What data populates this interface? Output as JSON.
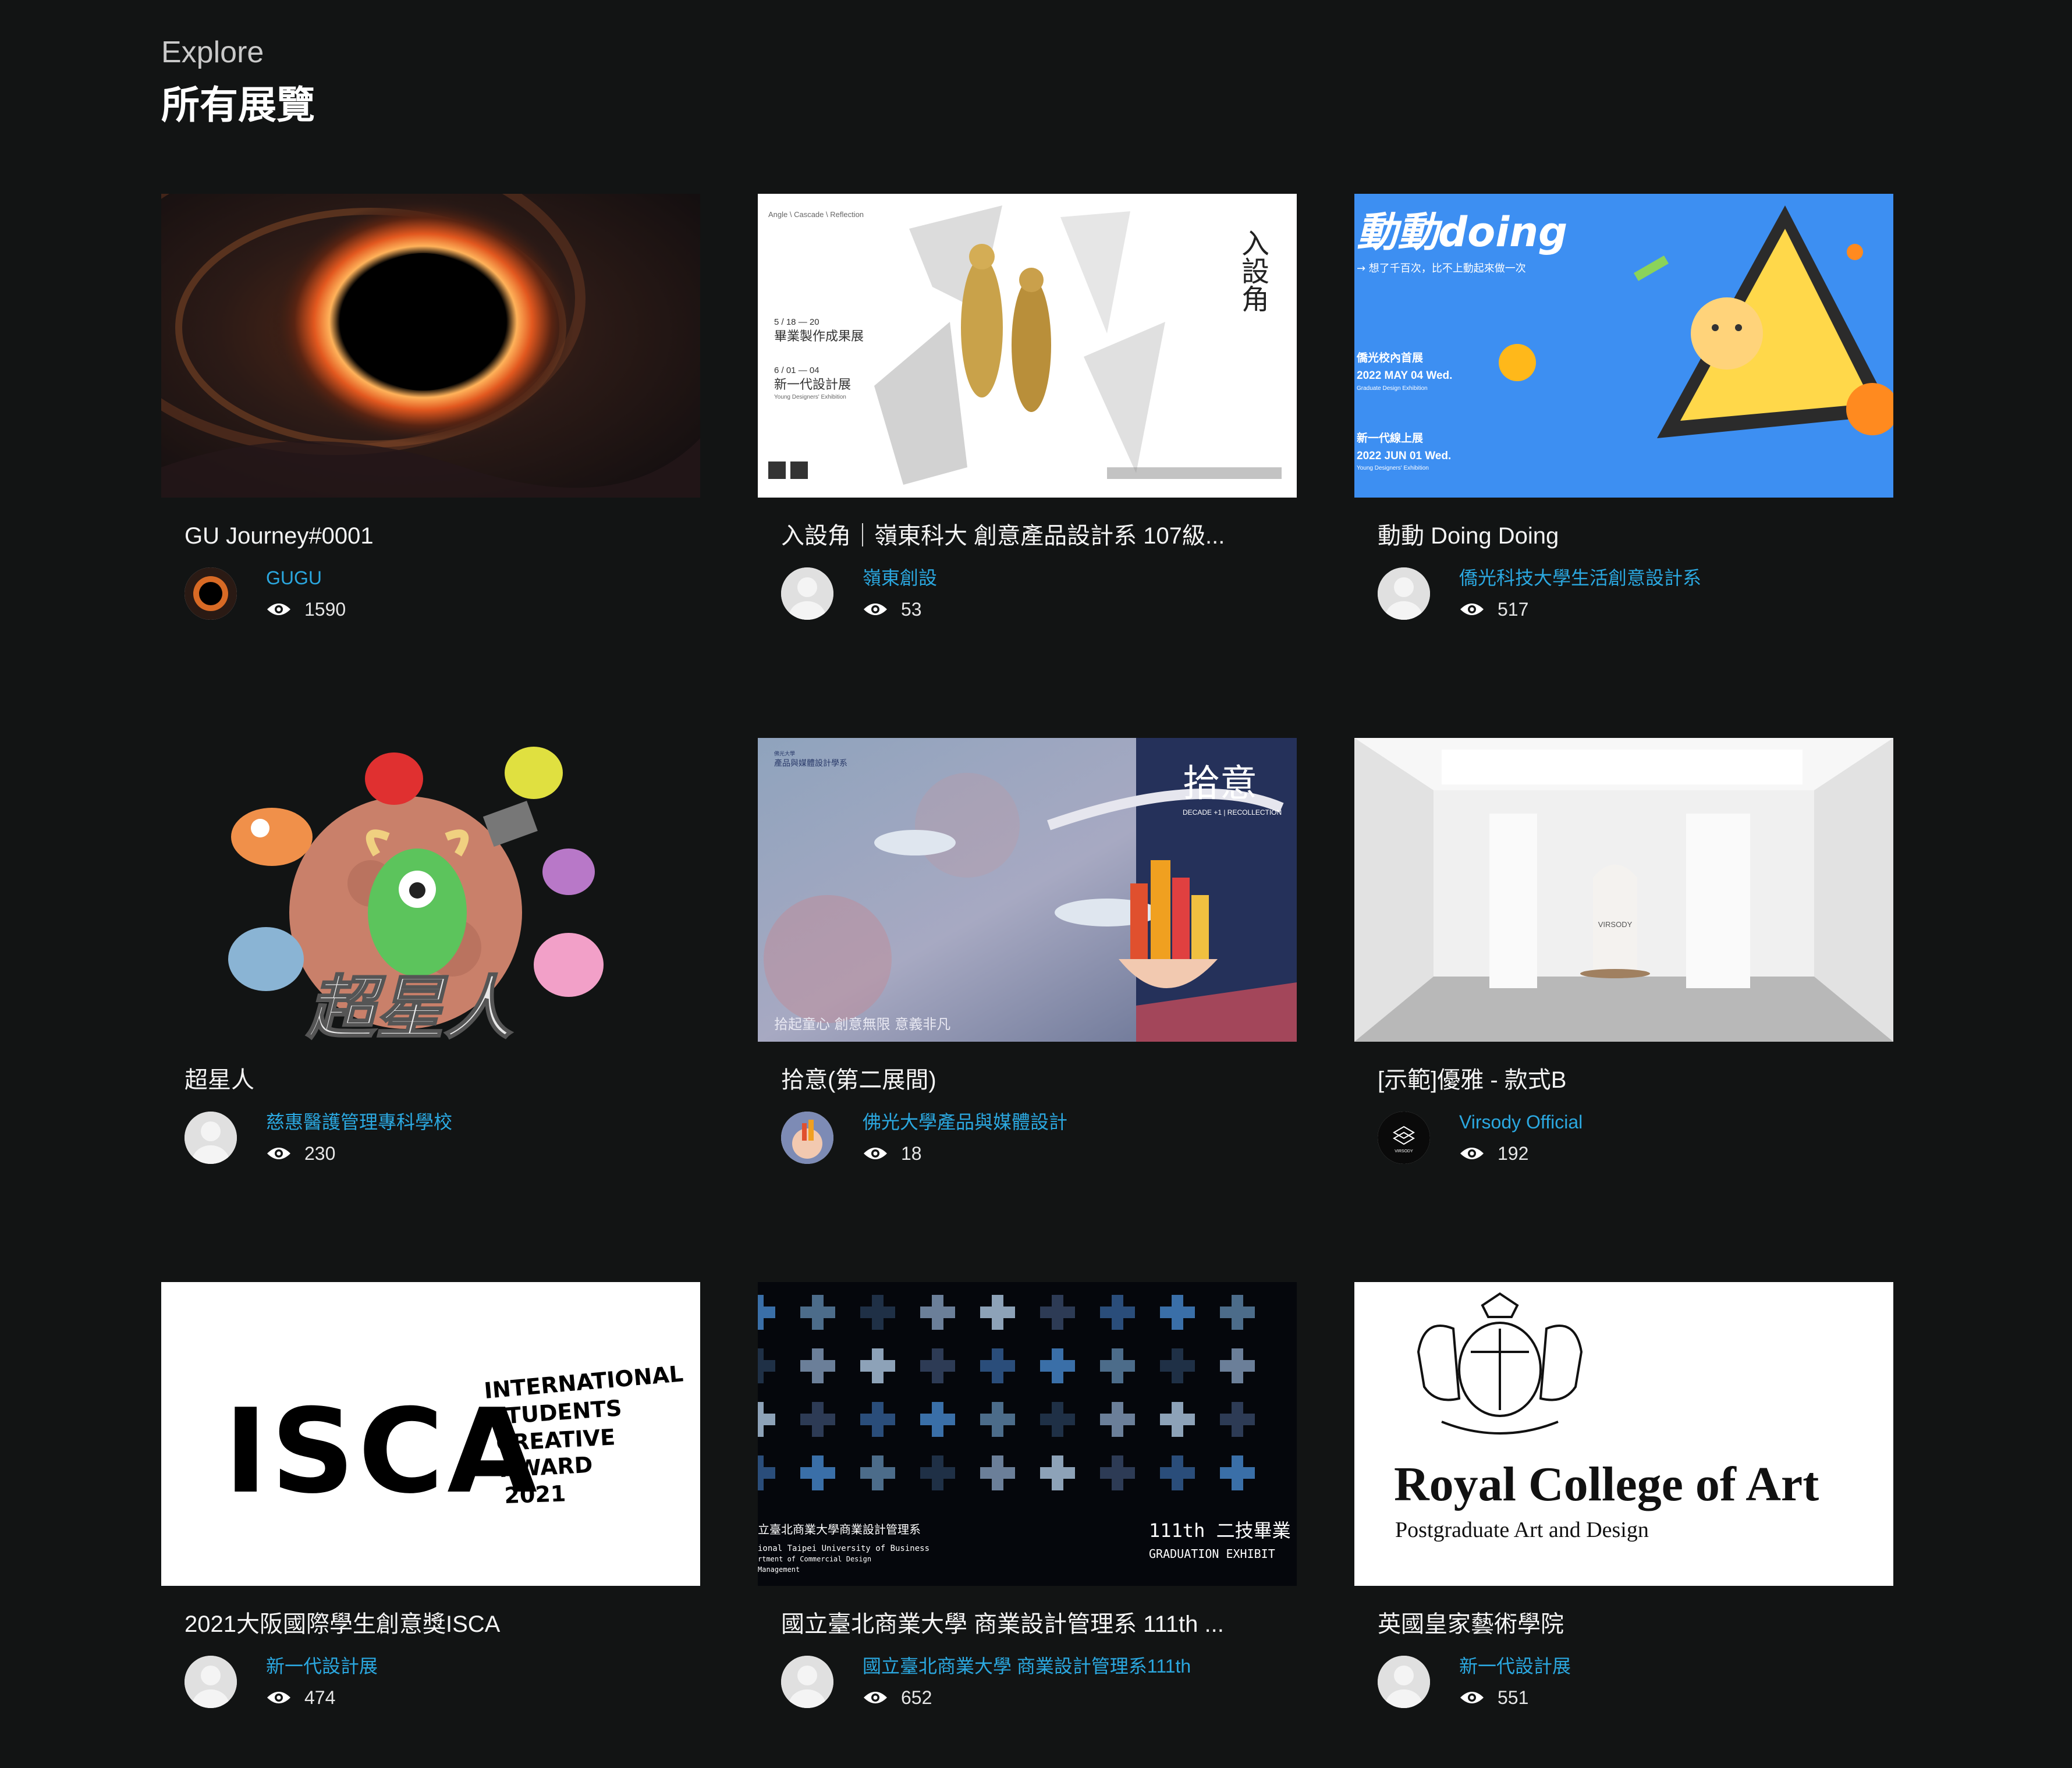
{
  "header": {
    "eyebrow": "Explore",
    "title": "所有展覽"
  },
  "cards": [
    {
      "title": "GU Journey#0001",
      "author": "GUGU",
      "views": "1590",
      "avatar": "blackhole-avatar"
    },
    {
      "title": "入設角｜嶺東科大 創意產品設計系 107級...",
      "author": "嶺東創設",
      "views": "53",
      "avatar": "default-avatar",
      "thumb_text": {
        "top": "Angle  \\  Cascade  \\  Reflection",
        "d1": "5 / 18 — 20",
        "e1": "畢業製作成果展",
        "d2": "6 / 01 — 04",
        "e2": "新一代設計展",
        "e2sub": "Young Designers' Exhibition",
        "vert": "入設角"
      }
    },
    {
      "title": "動動 Doing Doing",
      "author": "僑光科技大學生活創意設計系",
      "views": "517",
      "avatar": "default-avatar",
      "thumb_text": {
        "logo": "動動doing",
        "slogan": "→ 想了千百次，比不上動起來做一次",
        "l1": "僑光校內首展",
        "l2": "2022 MAY 04 Wed.",
        "l3": "Graduate Design Exhibition",
        "l4": "新一代線上展",
        "l5": "2022 JUN 01 Wed.",
        "l6": "Young Designers' Exhibition"
      }
    },
    {
      "title": "超星人",
      "author": "慈惠醫護管理專科學校",
      "views": "230",
      "avatar": "default-avatar",
      "thumb_text": {
        "logo": "超星人"
      }
    },
    {
      "title": "拾意(第二展間)",
      "author": "佛光大學產品與媒體設計",
      "views": "18",
      "avatar": "city-avatar",
      "thumb_text": {
        "logo": "拾意",
        "sub": "DECADE +1 | RECOLLECTION",
        "bottom": "拾起童心 創意無限 意義非凡",
        "dept": "產品與媒體設計學系"
      }
    },
    {
      "title": "[示範]優雅 - 款式B",
      "author": "Virsody Official",
      "views": "192",
      "avatar": "virsody-avatar",
      "thumb_text": {
        "logo": "VIRSODY"
      }
    },
    {
      "title": "2021大阪國際學生創意獎ISCA",
      "author": "新一代設計展",
      "views": "474",
      "avatar": "default-avatar",
      "thumb_text": {
        "logo": "ISCA",
        "l1": "INTERNATIONAL",
        "l2": "STUDENTS",
        "l3": "CREATIVE",
        "l4": "AWARD",
        "l5": "2021"
      }
    },
    {
      "title": "國立臺北商業大學 商業設計管理系 111th ...",
      "author": "國立臺北商業大學 商業設計管理系111th",
      "views": "652",
      "avatar": "default-avatar",
      "thumb_text": {
        "l1": "立臺北商業大學商業設計管理系",
        "l2": "ional Taipei University of Business",
        "l3": "rtment of Commercial Design",
        "l4": "Management",
        "r1": "111th 二技畢業",
        "r2": "GRADUATION EXHIBIT"
      }
    },
    {
      "title": "英國皇家藝術學院",
      "author": "新一代設計展",
      "views": "551",
      "avatar": "default-avatar",
      "thumb_text": {
        "logo": "Royal College of Art",
        "sub": "Postgraduate Art and Design"
      }
    }
  ]
}
